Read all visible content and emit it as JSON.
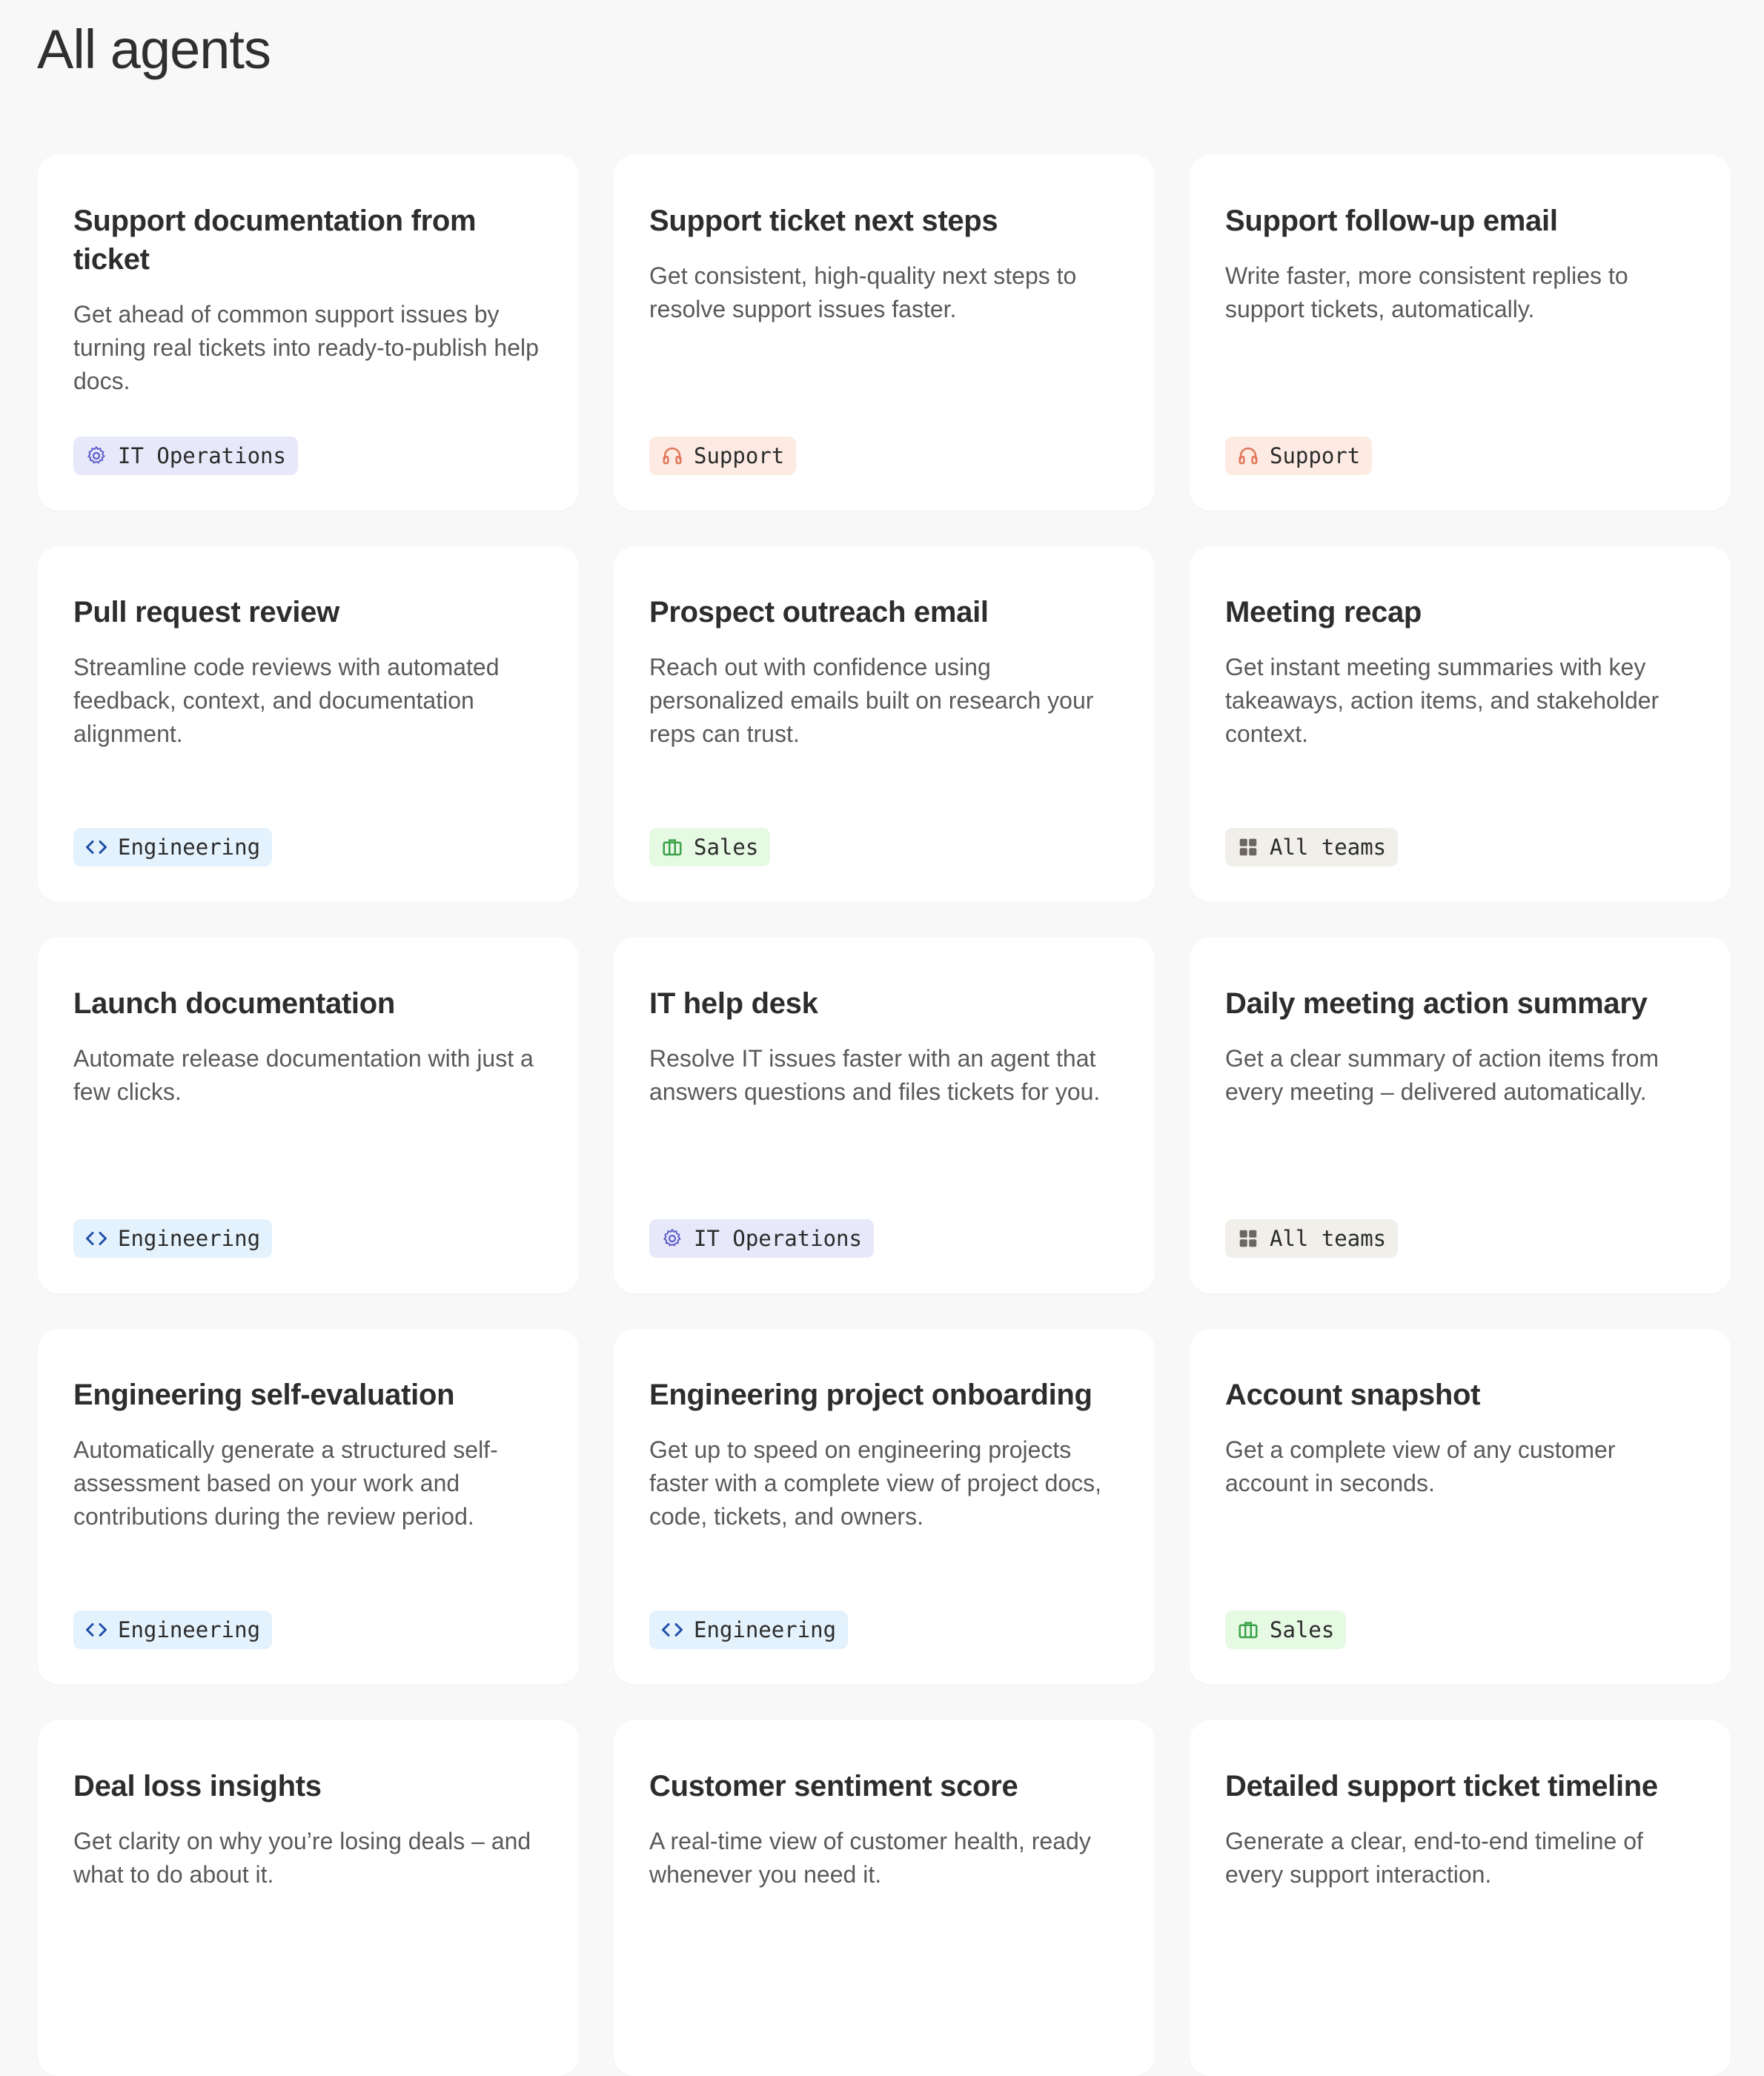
{
  "page": {
    "title": "All agents"
  },
  "colors": {
    "background": "#f8f8f8",
    "card": "#ffffff",
    "it_operations_badge": "#e8e8fb",
    "support_badge": "#fdeae3",
    "engineering_badge": "#e4f2fd",
    "sales_badge": "#e6f9e3",
    "all_teams_badge": "#f1efea"
  },
  "cards": [
    {
      "title": "Support documentation from ticket",
      "description": "Get ahead of common support issues by turning real tickets into ready-to-publish help docs.",
      "team": "IT Operations",
      "icon": "gear-icon"
    },
    {
      "title": "Support ticket next steps",
      "description": "Get consistent, high-quality next steps to resolve support issues faster.",
      "team": "Support",
      "icon": "headset-icon"
    },
    {
      "title": "Support follow-up email",
      "description": "Write faster, more consistent replies to support tickets, automatically.",
      "team": "Support",
      "icon": "headset-icon"
    },
    {
      "title": "Pull request review",
      "description": "Streamline code reviews with automated feedback, context, and documentation alignment.",
      "team": "Engineering",
      "icon": "code-icon"
    },
    {
      "title": "Prospect outreach email",
      "description": "Reach out with confidence using personalized emails built on research your reps can trust.",
      "team": "Sales",
      "icon": "briefcase-icon"
    },
    {
      "title": "Meeting recap",
      "description": "Get instant meeting summaries with key takeaways, action items, and stakeholder context.",
      "team": "All teams",
      "icon": "grid-icon"
    },
    {
      "title": "Launch documentation",
      "description": "Automate release documentation with just a few clicks.",
      "team": "Engineering",
      "icon": "code-icon"
    },
    {
      "title": "IT help desk",
      "description": "Resolve IT issues faster with an agent that answers questions and files tickets for you.",
      "team": "IT Operations",
      "icon": "gear-icon"
    },
    {
      "title": "Daily meeting action summary",
      "description": "Get a clear summary of action items from every meeting – delivered automatically.",
      "team": "All teams",
      "icon": "grid-icon"
    },
    {
      "title": "Engineering self-evaluation",
      "description": "Automatically generate a structured self-assessment based on your work and contributions during the review period.",
      "team": "Engineering",
      "icon": "code-icon"
    },
    {
      "title": "Engineering project onboarding",
      "description": "Get up to speed on engineering projects faster with a complete view of project docs, code, tickets, and owners.",
      "team": "Engineering",
      "icon": "code-icon"
    },
    {
      "title": "Account snapshot",
      "description": "Get a complete view of any customer account in seconds.",
      "team": "Sales",
      "icon": "briefcase-icon"
    },
    {
      "title": "Deal loss insights",
      "description": "Get clarity on why you’re losing deals – and what to do about it.",
      "team": "",
      "icon": ""
    },
    {
      "title": "Customer sentiment score",
      "description": "A real-time view of customer health, ready whenever you need it.",
      "team": "",
      "icon": ""
    },
    {
      "title": "Detailed support ticket timeline",
      "description": "Generate a clear, end-to-end timeline of every support interaction.",
      "team": "",
      "icon": ""
    }
  ]
}
